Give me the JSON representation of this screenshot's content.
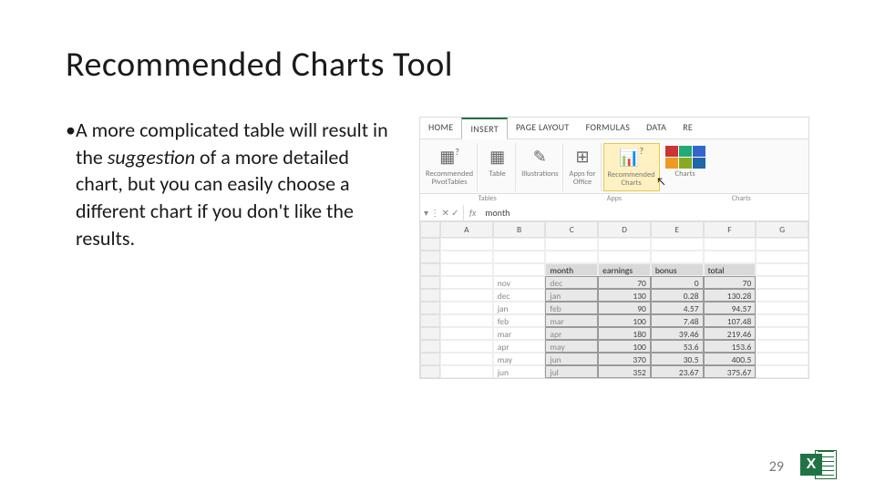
{
  "slide": {
    "title": "Recommended Charts Tool",
    "bullet_html": "A more complicated table will result in the <em>suggestion</em> of a more detailed chart, but you can easily choose a different chart if you don't like the results.",
    "page_number": "29"
  },
  "excel": {
    "tabs": [
      "HOME",
      "INSERT",
      "PAGE LAYOUT",
      "FORMULAS",
      "DATA",
      "RE"
    ],
    "active_tab": "INSERT",
    "ribbon_groups": {
      "pivot": "Recommended\nPivotTables",
      "table": "Table",
      "illus": "Illustrations",
      "apps": "Apps for\nOffice",
      "rec_charts": "Recommended\nCharts",
      "charts": "Charts"
    },
    "group_row": {
      "tables": "Tables",
      "apps": "Apps",
      "charts": "Charts"
    },
    "formula_bar": {
      "fx": "fx",
      "value": "month"
    },
    "col_headers": [
      "A",
      "B",
      "C",
      "D",
      "E",
      "F",
      "G"
    ],
    "left_months": [
      "nov",
      "dec",
      "jan",
      "feb",
      "mar",
      "apr",
      "may",
      "jun"
    ],
    "sel_header": [
      "month",
      "earnings",
      "bonus",
      "total"
    ],
    "rows": [
      {
        "m": "dec",
        "e": "70",
        "b": "0",
        "t": "70"
      },
      {
        "m": "jan",
        "e": "130",
        "b": "0.28",
        "t": "130.28"
      },
      {
        "m": "feb",
        "e": "90",
        "b": "4.57",
        "t": "94.57"
      },
      {
        "m": "mar",
        "e": "100",
        "b": "7.48",
        "t": "107.48"
      },
      {
        "m": "apr",
        "e": "180",
        "b": "39.46",
        "t": "219.46"
      },
      {
        "m": "may",
        "e": "100",
        "b": "53.6",
        "t": "153.6"
      },
      {
        "m": "jun",
        "e": "370",
        "b": "30.5",
        "t": "400.5"
      },
      {
        "m": "jul",
        "e": "352",
        "b": "23.67",
        "t": "375.67"
      }
    ]
  },
  "logo": {
    "letter": "X"
  }
}
